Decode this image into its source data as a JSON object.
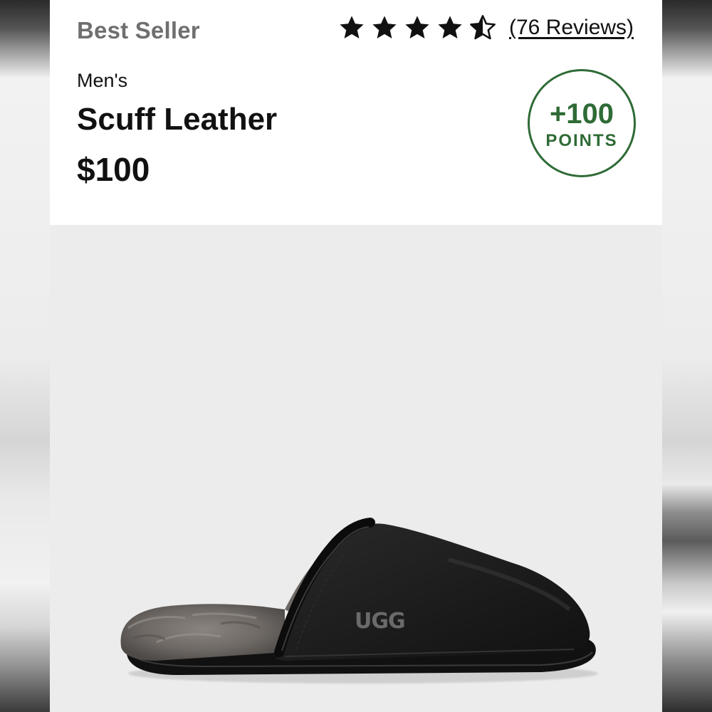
{
  "product": {
    "tag": "Best Seller",
    "rating": {
      "value": 4.5,
      "max": 5,
      "reviews_label": "(76 Reviews)"
    },
    "gender": "Men's",
    "name": "Scuff Leather",
    "price": "$100",
    "points": {
      "amount": "+100",
      "unit": "POINTS"
    },
    "image": {
      "brand_mark": "UGG",
      "icon": "slipper-image"
    }
  },
  "colors": {
    "points_green": "#2f6b36",
    "text": "#111111",
    "tag_gray": "#6f6f6f",
    "image_background": "#ececec"
  }
}
